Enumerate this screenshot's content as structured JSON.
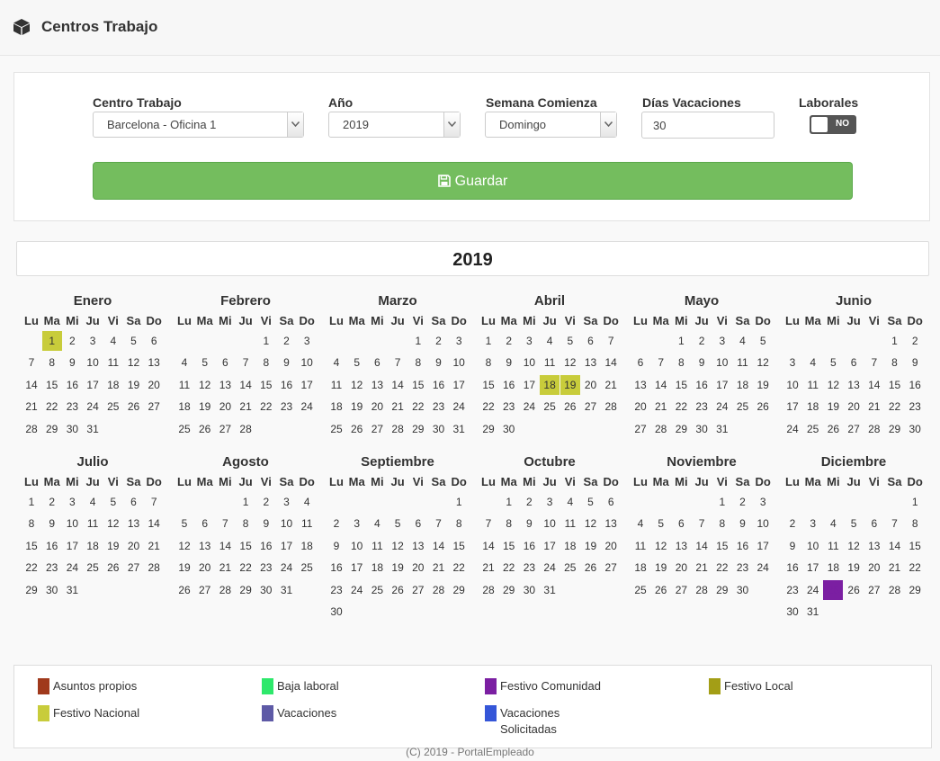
{
  "header": {
    "title": "Centros Trabajo",
    "icon": "cube-icon"
  },
  "form": {
    "centro_label": "Centro Trabajo",
    "centro_value": "Barcelona - Oficina 1",
    "anio_label": "Año",
    "anio_value": "2019",
    "semana_label": "Semana Comienza",
    "semana_value": "Domingo",
    "dias_label": "Días Vacaciones",
    "dias_value": "30",
    "laborales_label": "Laborales",
    "laborales_toggle": "NO",
    "save_label": "Guardar"
  },
  "calendar": {
    "year_title": "2019",
    "weekdays": [
      "Lu",
      "Ma",
      "Mi",
      "Ju",
      "Vi",
      "Sa",
      "Do"
    ],
    "months": [
      {
        "name": "Enero",
        "first": 1,
        "days": 31,
        "highlights": {
          "1": "nacional"
        }
      },
      {
        "name": "Febrero",
        "first": 4,
        "days": 28,
        "highlights": {}
      },
      {
        "name": "Marzo",
        "first": 4,
        "days": 31,
        "highlights": {}
      },
      {
        "name": "Abril",
        "first": 0,
        "days": 30,
        "highlights": {
          "18": "nacional",
          "19": "nacional"
        }
      },
      {
        "name": "Mayo",
        "first": 2,
        "days": 31,
        "highlights": {}
      },
      {
        "name": "Junio",
        "first": 5,
        "days": 30,
        "highlights": {}
      },
      {
        "name": "Julio",
        "first": 0,
        "days": 31,
        "highlights": {}
      },
      {
        "name": "Agosto",
        "first": 3,
        "days": 31,
        "highlights": {}
      },
      {
        "name": "Septiembre",
        "first": 6,
        "days": 30,
        "highlights": {}
      },
      {
        "name": "Octubre",
        "first": 1,
        "days": 31,
        "highlights": {}
      },
      {
        "name": "Noviembre",
        "first": 4,
        "days": 30,
        "highlights": {}
      },
      {
        "name": "Diciembre",
        "first": 6,
        "days": 31,
        "highlights": {
          "25": "comunidad"
        }
      }
    ]
  },
  "legend": [
    {
      "label": "Asuntos propios",
      "color": "#a0391c"
    },
    {
      "label": "Baja laboral",
      "color": "#2ee86b"
    },
    {
      "label": "Festivo Comunidad",
      "color": "#7b1fa2"
    },
    {
      "label": "Festivo Local",
      "color": "#a39e16"
    },
    {
      "label": "Festivo Nacional",
      "color": "#c8cc3b"
    },
    {
      "label": "Vacaciones",
      "color": "#5e5aa6"
    },
    {
      "label": "Vacaciones Solicitadas",
      "color": "#3556d8"
    }
  ],
  "footer": "(C) 2019 - PortalEmpleado"
}
